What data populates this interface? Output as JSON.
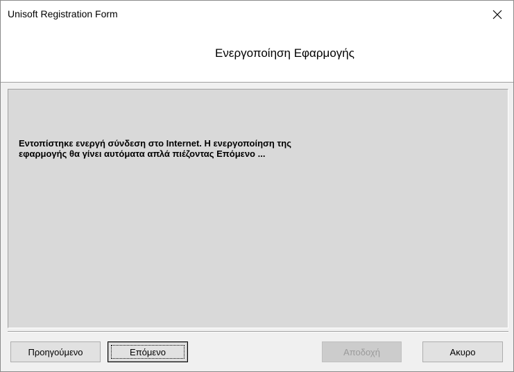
{
  "window": {
    "title": "Unisoft Registration Form",
    "close_icon": "close-icon"
  },
  "header": {
    "title": "Ενεργοποίηση Εφαρμογής"
  },
  "content": {
    "message_line1": "Εντοπίστηκε ενεργή σύνδεση στο Internet. Η ενεργοποίηση της",
    "message_line2": "εφαρμογής θα γίνει αυτόματα απλά πιέζοντας Επόμενο ..."
  },
  "buttons": {
    "back_label": "Προηγούμενο",
    "next_label": "Επόμενο",
    "accept_label": "Αποδοχή",
    "accept_enabled": false,
    "cancel_label": "Ακυρο"
  },
  "colors": {
    "content_background": "#d9d9d9",
    "window_background": "#f0f0f0",
    "disabled_text": "#9a9a9a"
  }
}
